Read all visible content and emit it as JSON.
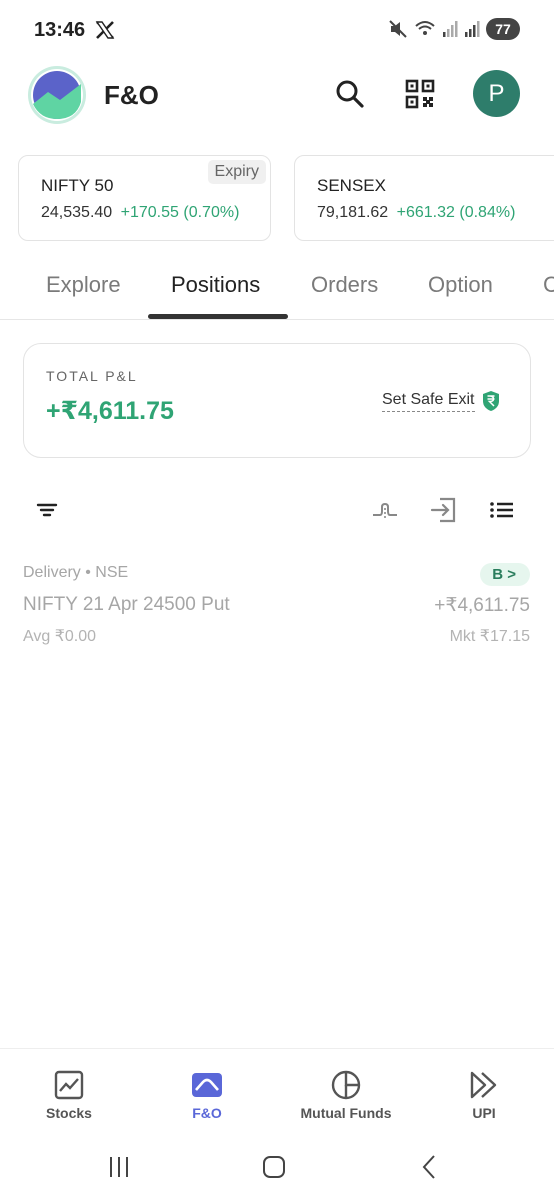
{
  "status_bar": {
    "time": "13:46",
    "battery": "77",
    "icons": [
      "x-logo-icon",
      "mute-icon",
      "wifi-icon",
      "signal-icon",
      "signal-icon",
      "battery-icon"
    ]
  },
  "header": {
    "title": "F&O",
    "avatar_initial": "P",
    "icons": [
      "app-logo-icon",
      "search-icon",
      "qr-code-icon"
    ]
  },
  "indices": [
    {
      "name": "NIFTY 50",
      "value": "24,535.40",
      "change": "+170.55 (0.70%)",
      "tag": "Expiry"
    },
    {
      "name": "SENSEX",
      "value": "79,181.62",
      "change": "+661.32 (0.84%)"
    }
  ],
  "tabs": [
    {
      "label": "Explore",
      "active": false
    },
    {
      "label": "Positions",
      "active": true
    },
    {
      "label": "Orders",
      "active": false
    },
    {
      "label": "Option",
      "active": false
    },
    {
      "label": "C",
      "active": false
    }
  ],
  "pnl": {
    "label": "TOTAL P&L",
    "value": "+₹4,611.75",
    "safe_exit_label": "Set Safe Exit"
  },
  "toolbar": {
    "icons": [
      "filter-icon",
      "strategy-chart-icon",
      "exit-position-icon",
      "list-view-icon"
    ]
  },
  "position": {
    "meta": "Delivery • NSE",
    "name": "NIFTY 21 Apr 24500 Put",
    "avg": "Avg ₹0.00",
    "badge": "B >",
    "pnl": "+₹4,611.75",
    "mkt": "Mkt ₹17.15"
  },
  "bottom_nav": [
    {
      "label": "Stocks",
      "icon": "stocks-chart-icon",
      "active": false
    },
    {
      "label": "F&O",
      "icon": "fno-icon",
      "active": true
    },
    {
      "label": "Mutual Funds",
      "icon": "pie-chart-icon",
      "active": false
    },
    {
      "label": "UPI",
      "icon": "upi-icon",
      "active": false
    }
  ],
  "colors": {
    "positive": "#2fa474",
    "active_nav": "#5a67d8",
    "avatar": "#2e7d6b"
  }
}
